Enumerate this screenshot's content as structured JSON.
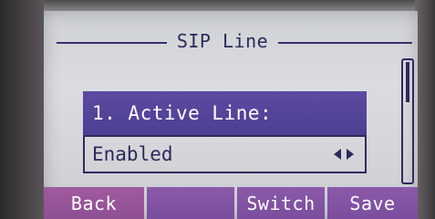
{
  "screen": {
    "title": "SIP Line"
  },
  "field": {
    "label": "1. Active Line:",
    "value": "Enabled",
    "switch_icon": "left-right-arrows-icon"
  },
  "softkeys": {
    "k1": "Back",
    "k2": "",
    "k3": "Switch",
    "k4": "Save"
  },
  "colors": {
    "accent": "#4b3f92",
    "softkey": "#7a4d9e",
    "lcd_background": "#d3d5d8",
    "ink": "#2b2a5a"
  }
}
